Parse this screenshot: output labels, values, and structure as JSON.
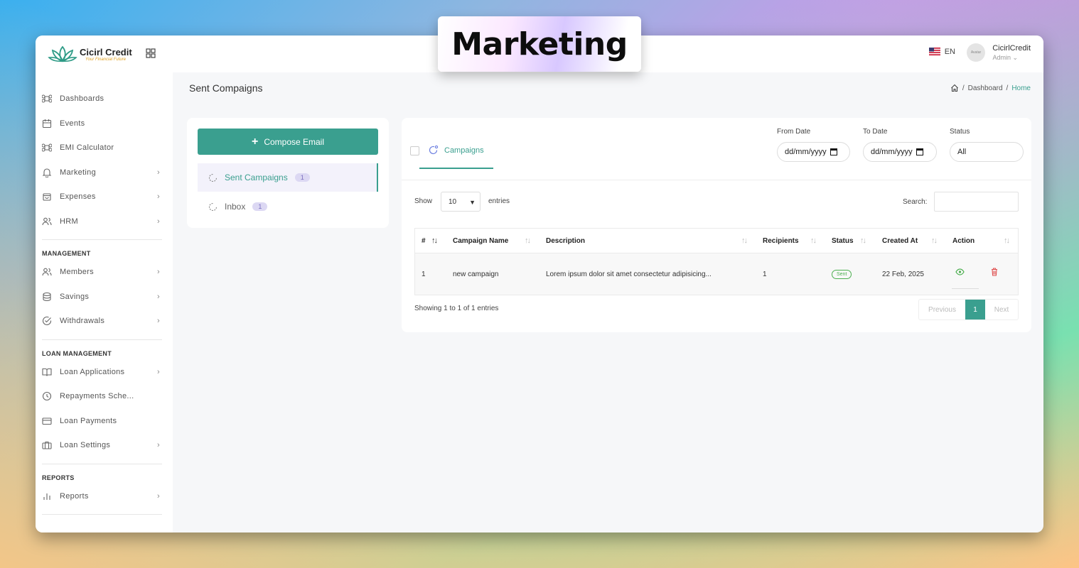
{
  "banner": {
    "title": "Marketing"
  },
  "brand": {
    "name": "Cicirl Credit",
    "tagline": "Your Financial Future"
  },
  "sidebar": {
    "items": [
      {
        "label": "Dashboards",
        "icon": "command-icon"
      },
      {
        "label": "Events",
        "icon": "calendar-icon"
      },
      {
        "label": "EMI Calculator",
        "icon": "command-icon"
      },
      {
        "label": "Marketing",
        "icon": "bell-icon"
      },
      {
        "label": "Expenses",
        "icon": "bag-icon"
      },
      {
        "label": "HRM",
        "icon": "users-icon"
      }
    ],
    "sections": [
      {
        "title": "MANAGEMENT",
        "items": [
          {
            "label": "Members",
            "icon": "users-icon"
          },
          {
            "label": "Savings",
            "icon": "database-icon"
          },
          {
            "label": "Withdrawals",
            "icon": "check-circle-icon"
          }
        ]
      },
      {
        "title": "LOAN MANAGEMENT",
        "items": [
          {
            "label": "Loan Applications",
            "icon": "book-icon"
          },
          {
            "label": "Repayments Sche...",
            "icon": "clock-icon"
          },
          {
            "label": "Loan Payments",
            "icon": "credit-card-icon"
          },
          {
            "label": "Loan Settings",
            "icon": "briefcase-icon"
          }
        ]
      },
      {
        "title": "REPORTS",
        "items": [
          {
            "label": "Reports",
            "icon": "bar-chart-icon"
          }
        ]
      }
    ]
  },
  "topbar": {
    "lang": "EN",
    "avatar_text": "Avatar",
    "user_name": "CicirlCredit",
    "user_role": "Admin ⌄"
  },
  "page": {
    "title": "Sent Compaigns",
    "breadcrumb": {
      "sep": "/",
      "dashboard": "Dashboard",
      "home": "Home"
    }
  },
  "mail": {
    "compose_label": "Compose Email",
    "folders": [
      {
        "label": "Sent Campaigns",
        "count": "1"
      },
      {
        "label": "Inbox",
        "count": "1"
      }
    ]
  },
  "filters": {
    "tab_label": "Campaigns",
    "from_label": "From Date",
    "from_value": "dd/mm/yyyy",
    "to_label": "To Date",
    "to_value": "dd/mm/yyyy",
    "status_label": "Status",
    "status_value": "All"
  },
  "table": {
    "show_label": "Show",
    "page_size": "10",
    "entries_label": "entries",
    "search_label": "Search:",
    "columns": [
      "#",
      "Campaign Name",
      "Description",
      "Recipients",
      "Status",
      "Created At",
      "Action"
    ],
    "rows": [
      {
        "id": "1",
        "name": "new campaign",
        "description": "Lorem ipsum dolor sit amet consectetur adipisicing...",
        "recipients": "1",
        "status": "Sent",
        "created": "22 Feb, 2025"
      }
    ],
    "info": "Showing 1 to 1 of 1 entries",
    "pager": {
      "prev": "Previous",
      "page": "1",
      "next": "Next"
    }
  },
  "colors": {
    "accent": "#3a9f8f",
    "badge_bg": "#dcd8f3",
    "danger": "#e05050",
    "success": "#4caf50"
  }
}
